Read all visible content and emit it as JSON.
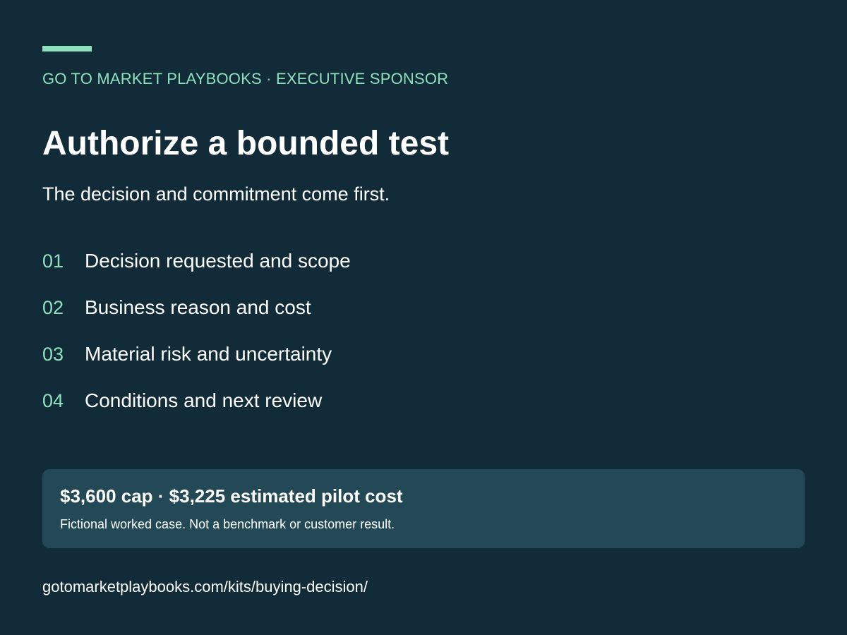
{
  "header": {
    "eyebrow": "GO TO MARKET PLAYBOOKS · EXECUTIVE SPONSOR",
    "title": "Authorize a bounded test",
    "subtitle": "The decision and commitment come first."
  },
  "steps": [
    {
      "number": "01",
      "label": "Decision requested and scope"
    },
    {
      "number": "02",
      "label": "Business reason and cost"
    },
    {
      "number": "03",
      "label": "Material risk and uncertainty"
    },
    {
      "number": "04",
      "label": "Conditions and next review"
    }
  ],
  "callout": {
    "headline": "$3,600 cap · $3,225 estimated pilot cost",
    "note": "Fictional worked case. Not a benchmark or customer result."
  },
  "footer": {
    "url": "gotomarketplaybooks.com/kits/buying-decision/"
  },
  "colors": {
    "background": "#122b38",
    "accent": "#8ee0bd",
    "callout_background": "#224955",
    "text": "#ffffff"
  }
}
